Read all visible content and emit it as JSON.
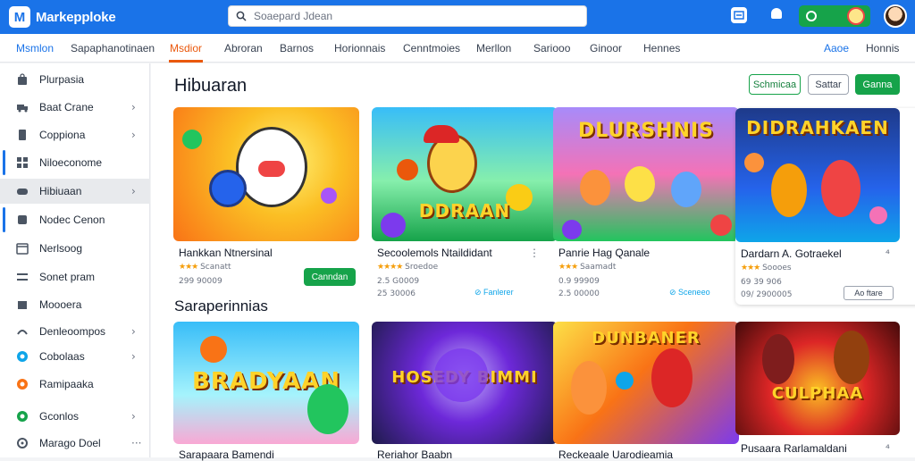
{
  "app": {
    "name": "Markepploke",
    "logo_letter": "M"
  },
  "search": {
    "placeholder": "Soaepard Jdean"
  },
  "nav_tabs": [
    "Msmlon",
    "Sapaphanotinaen",
    "Msdior",
    "Abroran",
    "Barnos",
    "Horionnais",
    "Cenntmoies",
    "Merllon",
    "Sariooo",
    "Ginoor",
    "Hennes",
    "Aaoe",
    "Honnis"
  ],
  "sidebar": {
    "items": [
      {
        "label": "Plurpasia",
        "icon": "bag-icon"
      },
      {
        "label": "Baat Crane",
        "icon": "truck-icon",
        "chevron": "›"
      },
      {
        "label": "Coppiona",
        "icon": "doc-icon",
        "chevron": "›"
      },
      {
        "label": "Niloeconome",
        "icon": "grid-icon"
      },
      {
        "label": "Hibiuaan",
        "icon": "gamepad-icon",
        "chevron": "›",
        "selected": true
      },
      {
        "label": "Nodec Cenon",
        "icon": "tag-icon"
      },
      {
        "label": "Nerlsoog",
        "icon": "calendar-icon"
      },
      {
        "label": "Sonet pram",
        "icon": "list-icon"
      },
      {
        "label": "Moooera",
        "icon": "box-icon"
      },
      {
        "label": "Denleoompos",
        "icon": "sliders-icon",
        "chevron": "›"
      },
      {
        "label": "Cobolaas",
        "icon": "globe-icon",
        "chevron": "›"
      },
      {
        "label": "Ramipaaka",
        "icon": "flame-icon"
      },
      {
        "label": "Gconlos",
        "icon": "leaf-icon",
        "chevron": "›"
      },
      {
        "label": "Marago Doel",
        "icon": "gear-icon",
        "chevron": "···"
      }
    ]
  },
  "main": {
    "section1_title": "Hibuaran",
    "section2_title": "Saraperinnias",
    "buttons": {
      "b1": "Schmicaa",
      "b2": "Sattar",
      "b3": "Ganna"
    },
    "cards_row1": [
      {
        "title": "Hankkan Ntnersinal",
        "stars": "★★★",
        "rating_text": "Scanatt",
        "meta1": "299 90009",
        "button": "Canndan"
      },
      {
        "title": "Secoolemols Ntaildidant",
        "stars": "★★★★",
        "rating_text": "Sroedoe",
        "meta1": "2.5 G0009",
        "meta2": "25 30006",
        "link_label": "Fanlerer",
        "more": "⋮"
      },
      {
        "title": "Panrie Hag Qanale",
        "stars": "★★★",
        "rating_text": "Saamadt",
        "meta1": "0.9 99909",
        "meta2": "2.5 00000",
        "link_label": "Sceneeo"
      },
      {
        "title": "Dardarn A. Gotraekel",
        "stars": "★★★",
        "rating_text": "Soooes",
        "meta1": "69 39 906",
        "meta2": "09/ 2900005",
        "chip": "Ao ftare",
        "more": "⁴"
      }
    ],
    "cards_row2": [
      {
        "title": "Sarapaara Bamendi"
      },
      {
        "title": "Reriahor Baabn"
      },
      {
        "title": "Reckeaale Uarodieamia"
      },
      {
        "title": "Pusaara Rarlamaldani",
        "more": "⁴"
      }
    ],
    "thumb_texts": [
      "DDRAAN",
      "DLURSHNIS",
      "DIDRAHKAEN",
      "BRADYAAN",
      "HOSEDY BIMMI",
      "DUNBANER",
      "CULPHAA"
    ]
  }
}
